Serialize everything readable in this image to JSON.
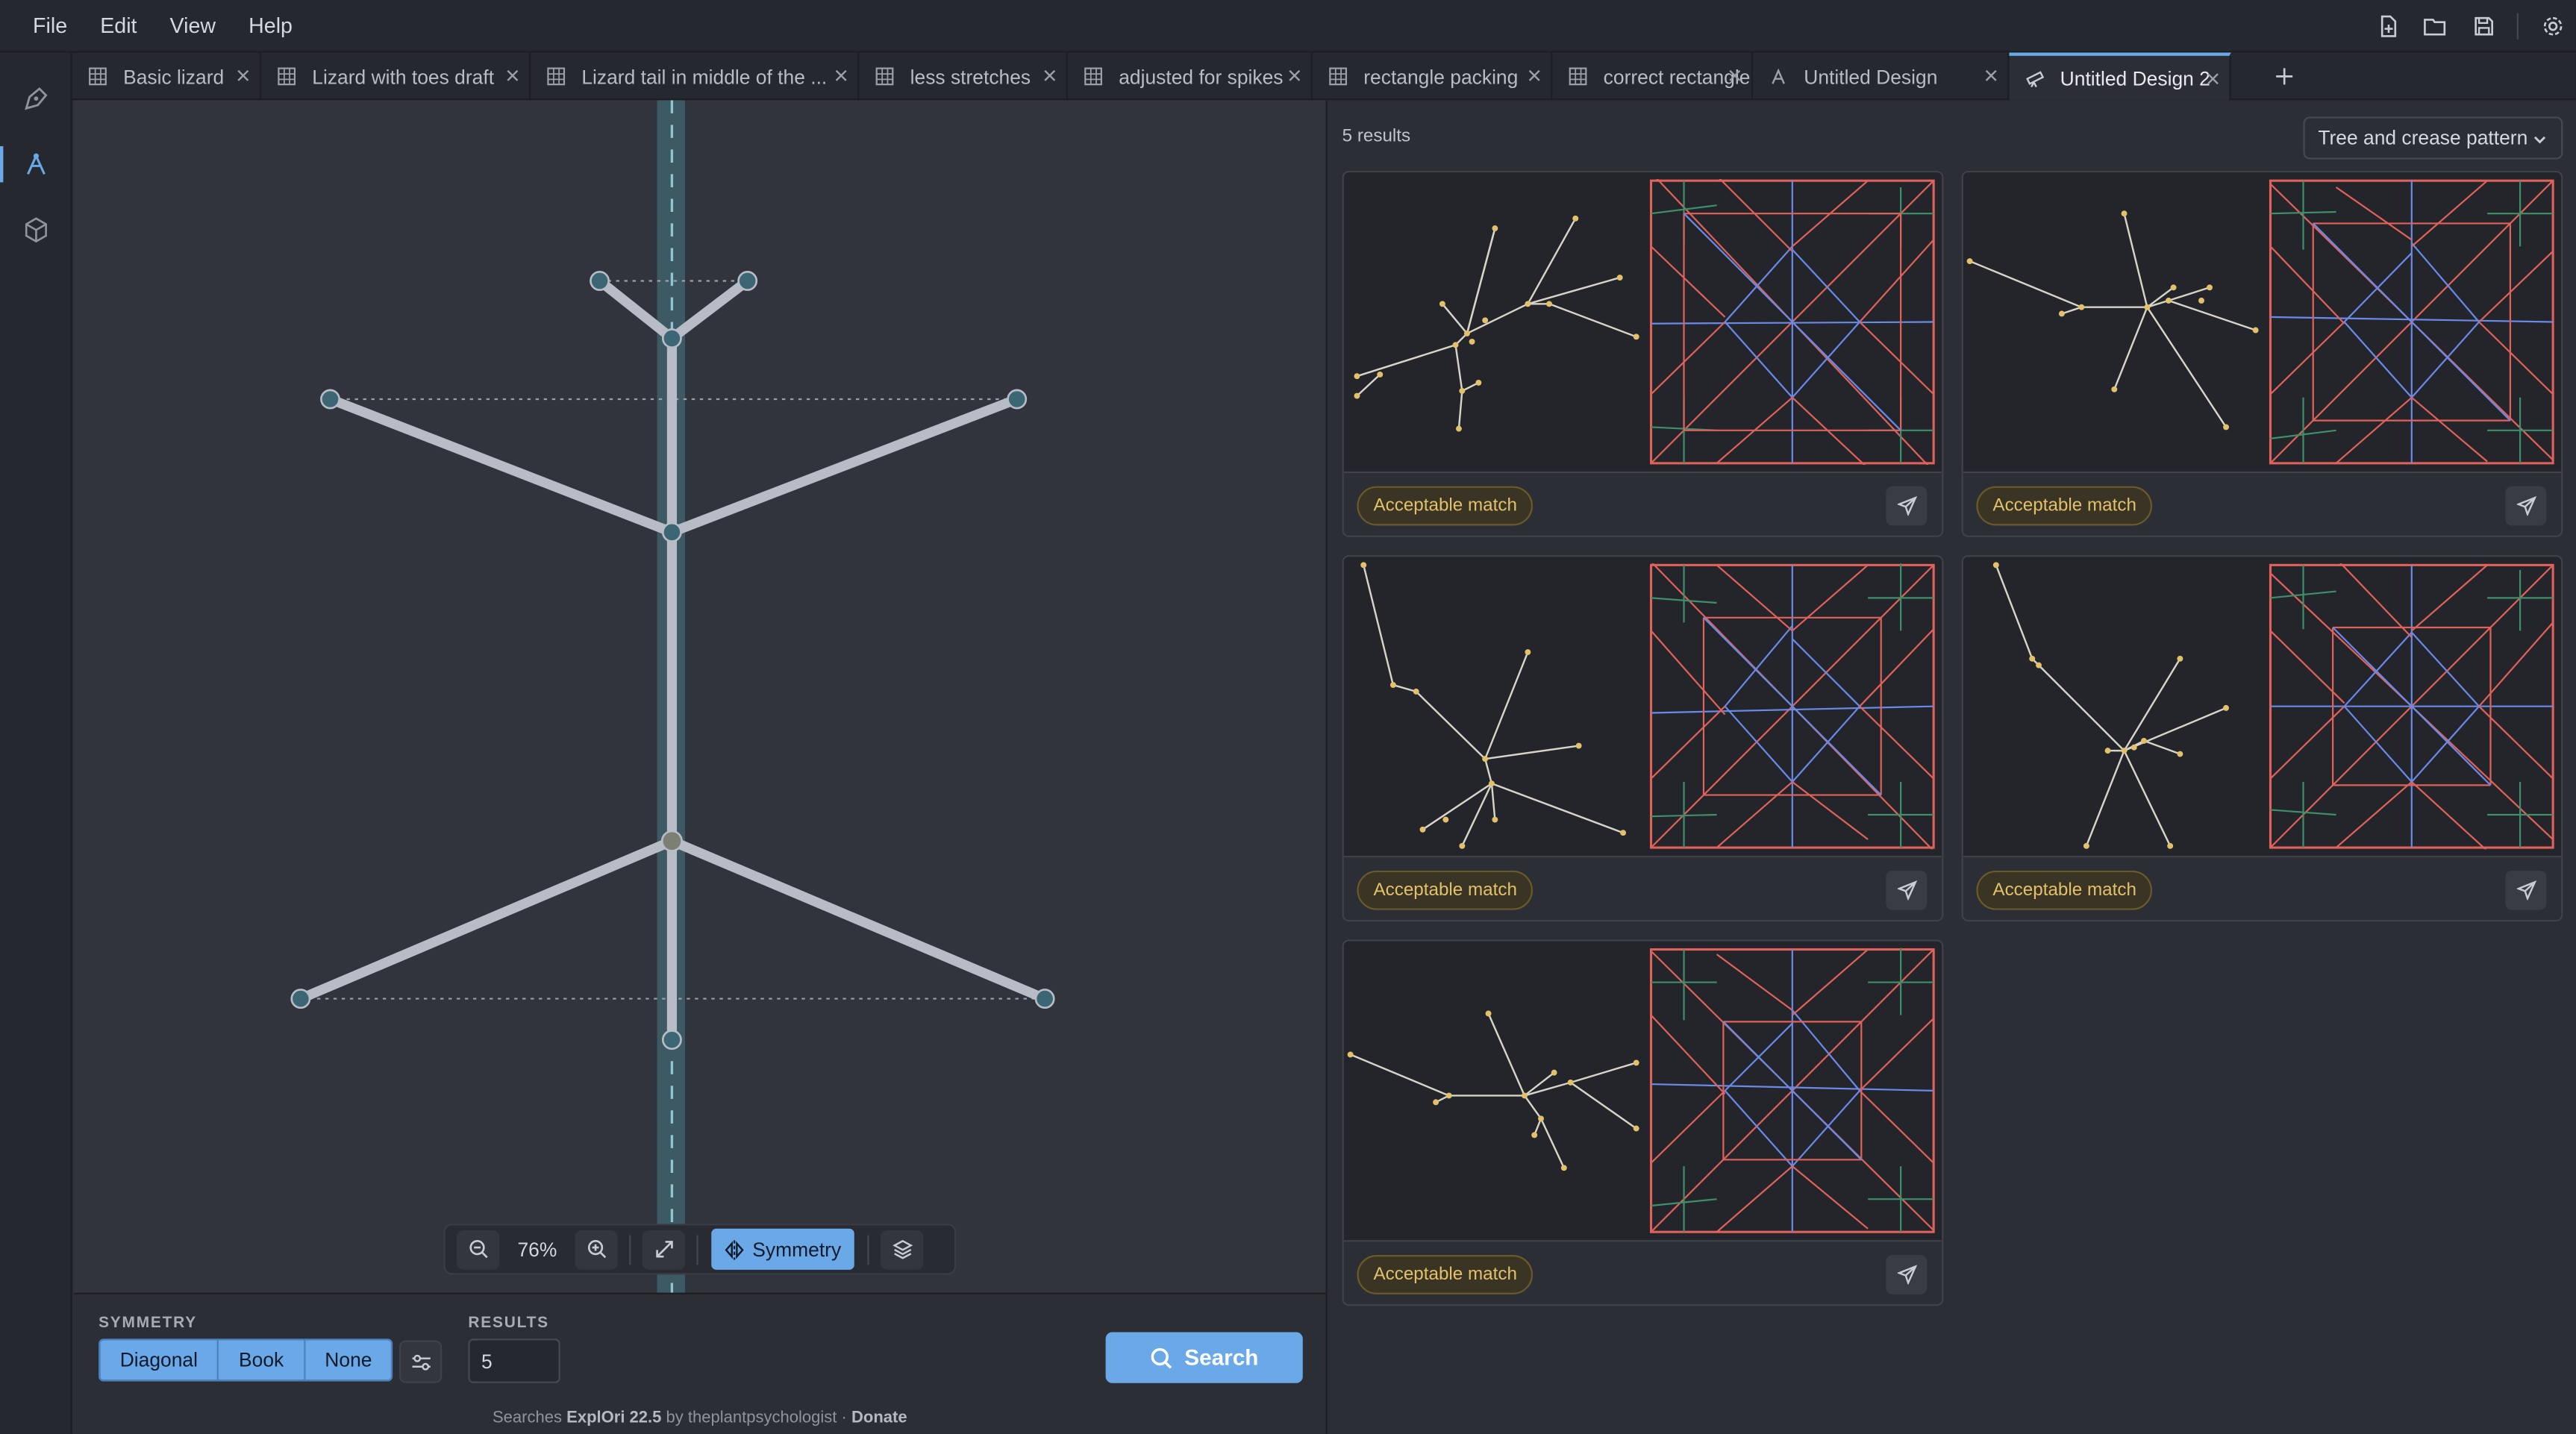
{
  "menu": [
    "File",
    "Edit",
    "View",
    "Help"
  ],
  "tabs": [
    {
      "label": "Basic lizard",
      "icon": "grid-icon"
    },
    {
      "label": "Lizard with toes draft",
      "icon": "grid-icon"
    },
    {
      "label": "Lizard tail in middle of the ...",
      "icon": "grid-icon"
    },
    {
      "label": "less stretches",
      "icon": "grid-icon"
    },
    {
      "label": "adjusted for spikes",
      "icon": "grid-icon"
    },
    {
      "label": "rectangle packing",
      "icon": "grid-icon"
    },
    {
      "label": "correct rectangle",
      "icon": "grid-icon"
    },
    {
      "label": "Untitled Design",
      "icon": "tree-icon"
    },
    {
      "label": "Untitled Design 2",
      "icon": "telescope-icon",
      "active": true
    }
  ],
  "toolbar": {
    "zoom": "76%",
    "symmetry_label": "Symmetry"
  },
  "bottom": {
    "symmetry_label": "SYMMETRY",
    "symmetry_options": [
      "Diagonal",
      "Book",
      "None"
    ],
    "results_label": "RESULTS",
    "results_value": "5",
    "search_label": "Search"
  },
  "footer": {
    "prefix": "Searches",
    "app": "ExplOri 22.5",
    "by": "by theplantpsychologist ·",
    "donate": "Donate"
  },
  "results": {
    "count": "5 results",
    "view_mode": "Tree and crease pattern",
    "cards": [
      {
        "badge": "Acceptable match"
      },
      {
        "badge": "Acceptable match"
      },
      {
        "badge": "Acceptable match"
      },
      {
        "badge": "Acceptable match"
      },
      {
        "badge": "Acceptable match"
      }
    ]
  },
  "colors": {
    "accent": "#6aa8e8",
    "mountain": "#e0625a",
    "valley": "#6a8ae8",
    "hinge": "#3f8f6a",
    "badge_text": "#e3c16a"
  }
}
